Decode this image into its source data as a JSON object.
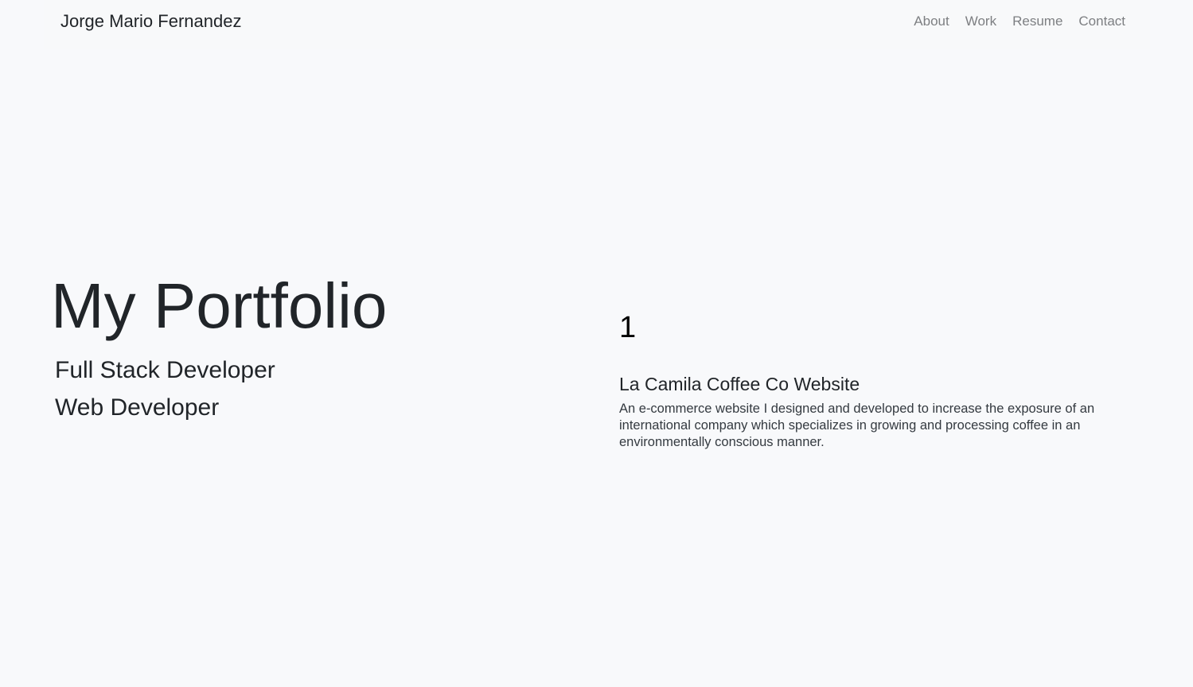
{
  "navbar": {
    "brand": "Jorge Mario Fernandez",
    "links": [
      "About",
      "Work",
      "Resume",
      "Contact"
    ]
  },
  "hero": {
    "title": "My Portfolio",
    "subtitles": [
      "Full Stack Developer",
      "Web Developer"
    ]
  },
  "project": {
    "number": "1",
    "title": "La Camila Coffee Co Website",
    "description": "An e-commerce website I designed and developed to increase the exposure of an international company which specializes in growing and processing coffee in an environmentally conscious manner."
  },
  "colors": {
    "background": "#f8f9fb",
    "text": "#212529",
    "nav_link": "#7d7f82"
  }
}
